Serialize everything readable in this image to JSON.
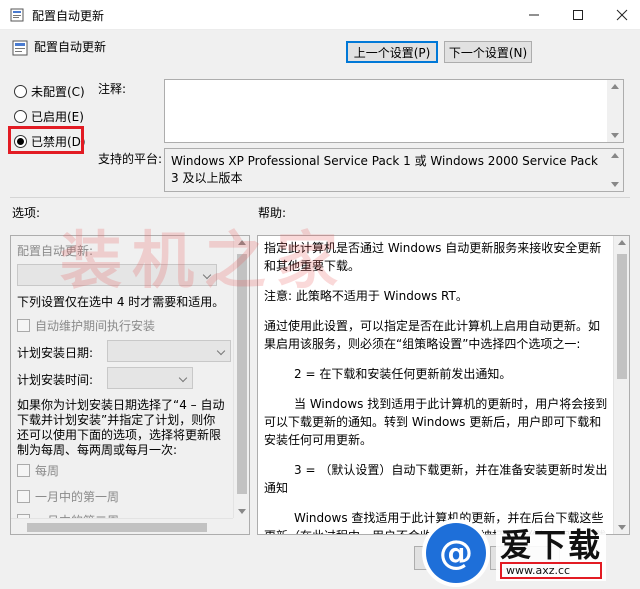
{
  "window": {
    "title": "配置自动更新"
  },
  "header": {
    "title": "配置自动更新",
    "prev_button": "上一个设置(P)",
    "next_button": "下一个设置(N)"
  },
  "state": {
    "options": [
      {
        "label": "未配置(C)",
        "checked": false
      },
      {
        "label": "已启用(E)",
        "checked": false
      },
      {
        "label": "已禁用(D)",
        "checked": true
      }
    ]
  },
  "comment": {
    "label": "注释:",
    "value": ""
  },
  "platform": {
    "label": "支持的平台:",
    "value": "Windows XP Professional Service Pack 1 或 Windows 2000 Service Pack 3 及以上版本"
  },
  "sections": {
    "options_label": "选项:",
    "help_label": "帮助:"
  },
  "options_panel": {
    "configure_label": "配置自动更新:",
    "note": "下列设置仅在选中 4 时才需要和适用。",
    "maintenance_checkbox": "自动维护期间执行安装",
    "schedule_day_label": "计划安装日期:",
    "schedule_time_label": "计划安装时间:",
    "description": "如果你为计划安装日期选择了“4 – 自动下载并计划安装”并指定了计划，则你还可以使用下面的选项，选择将更新限制为每周、每两周或每月一次:",
    "weekly_checkbox": "每周",
    "first_week_checkbox": "一月中的第一周",
    "second_week_checkbox": "一月中的第二周"
  },
  "help_text": {
    "p1": "指定此计算机是否通过 Windows 自动更新服务来接收安全更新和其他重要下载。",
    "p2": "注意: 此策略不适用于 Windows RT。",
    "p3": "通过使用此设置，可以指定是否在此计算机上启用自动更新。如果启用该服务，则必须在“组策略设置”中选择四个选项之一:",
    "p4": "2 = 在下载和安装任何更新前发出通知。",
    "p5": "当 Windows 找到适用于此计算机的更新时，用户将会接到可以下载更新的通知。转到 Windows 更新后，用户即可下载和安装任何可用更新。",
    "p6": "3 = （默认设置）自动下载更新，并在准备安装更新时发出通知",
    "p7": "Windows 查找适用于此计算机的更新，并在后台下载这些更新（在此过程中，用户不会收到通知或被打断工作）。完成下载后，用户将收到可以安装更新的通知。转到 Windows 更新后，用户即可安装更新。"
  },
  "watermark": {
    "text": "装机之家"
  },
  "logo": {
    "word": "爱下载",
    "url": "www.axz.cc"
  },
  "colors": {
    "highlight": "#e21b23",
    "logo_blue": "#1e6fd9"
  }
}
